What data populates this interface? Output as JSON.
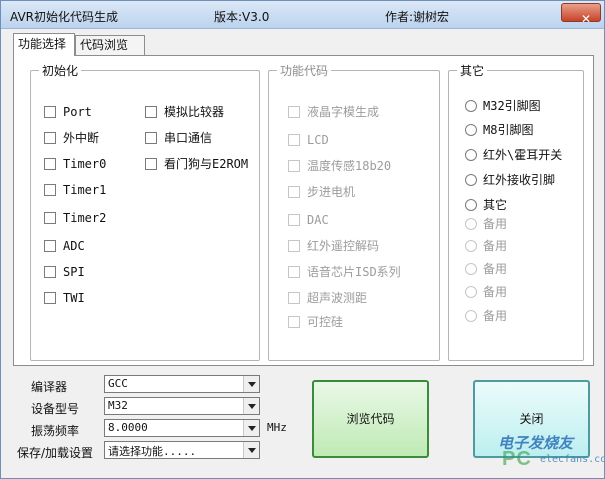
{
  "window": {
    "title": "AVR初始化代码生成",
    "version": "版本:V3.0",
    "author": "作者:谢树宏",
    "close_glyph": "✕"
  },
  "tabs": [
    {
      "label": "功能选择"
    },
    {
      "label": "代码浏览"
    }
  ],
  "init_group": {
    "legend": "初始化",
    "left": [
      "Port",
      "外中断",
      "Timer0",
      "Timer1",
      "Timer2",
      "ADC",
      "SPI",
      "TWI"
    ],
    "right": [
      "模拟比较器",
      "串口通信",
      "看门狗与E2ROM"
    ]
  },
  "func_group": {
    "legend": "功能代码",
    "items": [
      "液晶字模生成",
      "LCD",
      "温度传感18b20",
      "步进电机",
      "DAC",
      "红外遥控解码",
      "语音芯片ISD系列",
      "超声波测距",
      "可控硅"
    ]
  },
  "other_group": {
    "legend": "其它",
    "items": [
      "M32引脚图",
      "M8引脚图",
      "红外\\霍耳开关",
      "红外接收引脚",
      "其它"
    ],
    "disabled_items": [
      "备用",
      "备用",
      "备用",
      "备用",
      "备用"
    ]
  },
  "form": {
    "compiler_label": "编译器",
    "compiler_value": "GCC",
    "device_label": "设备型号",
    "device_value": "M32",
    "freq_label": "振荡频率",
    "freq_value": "8.0000",
    "freq_unit": "MHz",
    "save_label": "保存/加载设置",
    "save_value": "请选择功能....."
  },
  "buttons": {
    "browse_label": "浏览代码",
    "close_label": "关闭"
  },
  "watermark": {
    "brand": "电子发烧友",
    "site": "elecfans.com",
    "pc": "PC"
  }
}
